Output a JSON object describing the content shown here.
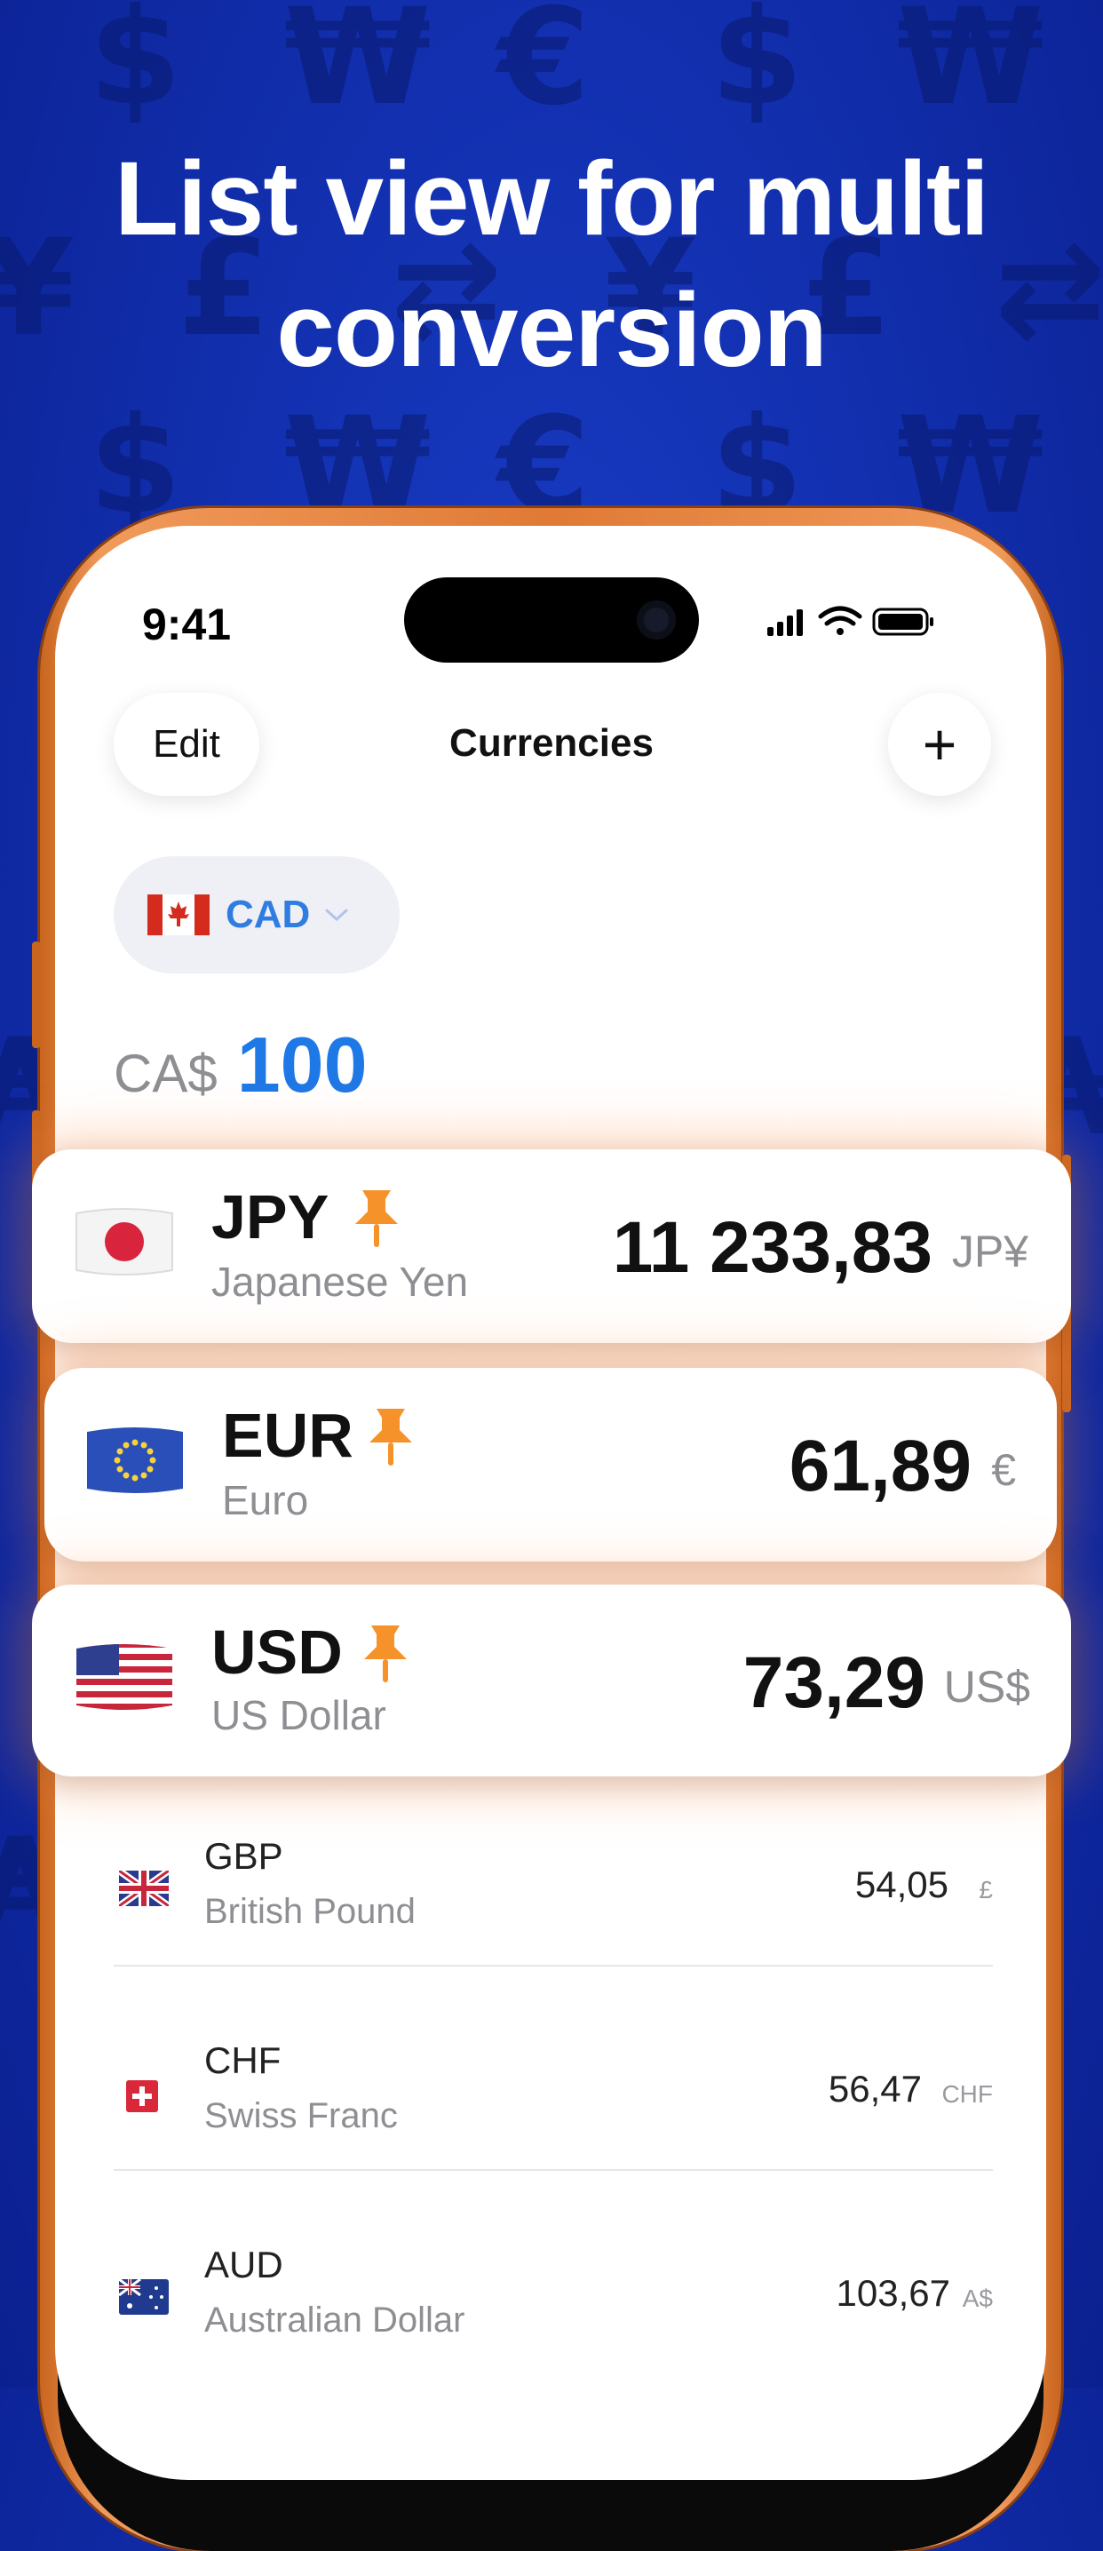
{
  "headline": [
    "List view for multi",
    "conversion"
  ],
  "status": {
    "time": "9:41"
  },
  "nav": {
    "edit_label": "Edit",
    "title": "Currencies",
    "add_label": "+"
  },
  "base": {
    "code": "CAD",
    "symbol": "CA$",
    "amount": "100"
  },
  "pinned": [
    {
      "code": "JPY",
      "name": "Japanese Yen",
      "value": "11 233,83",
      "unit": "JP¥",
      "flag": "japan-flag-icon"
    },
    {
      "code": "EUR",
      "name": "Euro",
      "value": "61,89",
      "unit": "€",
      "flag": "eu-flag-icon"
    },
    {
      "code": "USD",
      "name": "US Dollar",
      "value": "73,29",
      "unit": "US$",
      "flag": "us-flag-icon"
    }
  ],
  "list": [
    {
      "code": "GBP",
      "name": "British Pound",
      "value": "54,05",
      "unit": "£",
      "flag": "uk-flag-icon"
    },
    {
      "code": "CHF",
      "name": "Swiss Franc",
      "value": "56,47",
      "unit": "CHF",
      "flag": "swiss-flag-icon"
    },
    {
      "code": "AUD",
      "name": "Australian Dollar",
      "value": "103,67",
      "unit": "A$",
      "flag": "australia-flag-icon"
    }
  ],
  "colors": {
    "accent": "#1e78e6",
    "pin": "#f5932a",
    "background": "#1230b0",
    "phone_frame": "#e07a36"
  }
}
